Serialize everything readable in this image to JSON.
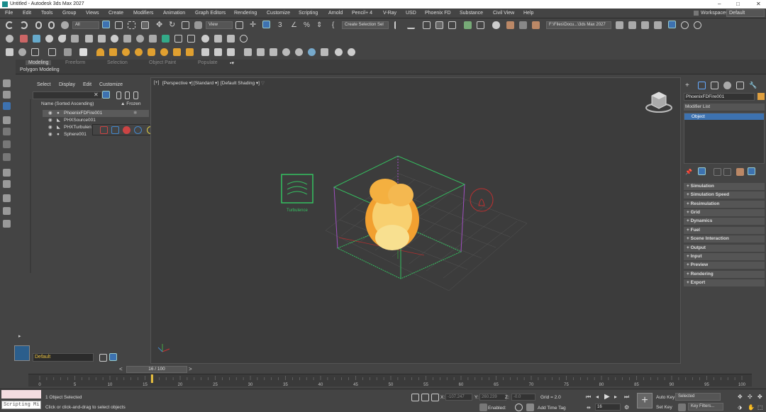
{
  "window": {
    "title": "Untitled - Autodesk 3ds Max 2027",
    "controls": [
      "–",
      "□",
      "✕"
    ]
  },
  "menubar": {
    "items": [
      "File",
      "Edit",
      "Tools",
      "Group",
      "Views",
      "Create",
      "Modifiers",
      "Animation",
      "Graph Editors",
      "Rendering",
      "Customize",
      "Scripting",
      "Arnold",
      "Pencil+ 4",
      "V-Ray",
      "USD",
      "Phoenix FD",
      "Substance",
      "Civil View",
      "Help"
    ],
    "workspace_label": "Workspaces:",
    "workspace_value": "Default"
  },
  "toolbar": {
    "selection_filter": "All",
    "ref_coord": "View",
    "named_selection": "Create Selection Sel",
    "project_path": "F:\\Files\\Docu...\\3ds Max 2027"
  },
  "ribbon": {
    "tabs": [
      "Modeling",
      "Freeform",
      "Selection",
      "Object Paint",
      "Populate"
    ],
    "active_tab": "Modeling",
    "sub_label": "Polygon Modeling"
  },
  "scene_explorer": {
    "menu": [
      "Select",
      "Display",
      "Edit",
      "Customize"
    ],
    "header_name": "Name (Sorted Ascending)",
    "header_frozen": "▲ Frozen",
    "rows": [
      "PhoenixFDFire001",
      "PHXSource001",
      "PHXTurbulen",
      "Sphere001"
    ],
    "layer": "Default"
  },
  "viewport": {
    "labels": [
      "[+]",
      "[Perspective ▾]",
      "[Standard ▾]",
      "[Default Shading ▾]"
    ],
    "turbulence_label": "Turbulence"
  },
  "command_panel": {
    "object_name": "PhoenixFDFire001",
    "modifier_list": "Modifier List",
    "stack_item": "Object",
    "rollouts": [
      "Simulation",
      "Simulation Speed",
      "Resimulation",
      "Grid",
      "Dynamics",
      "Fuel",
      "Scene Interaction",
      "Output",
      "Input",
      "Preview",
      "Rendering",
      "Export"
    ]
  },
  "timeline": {
    "slider": "16 / 100",
    "ticks": [
      "0",
      "5",
      "10",
      "15",
      "20",
      "25",
      "30",
      "35",
      "40",
      "45",
      "50",
      "55",
      "60",
      "65",
      "70",
      "75",
      "80",
      "85",
      "90",
      "95",
      "100"
    ],
    "current_frame": 16
  },
  "status": {
    "maxscript": "Scripting Mi",
    "selection": "1 Object Selected",
    "prompt": "Click or click-and-drag to select objects",
    "x_label": "X:",
    "x_value": "-107.247",
    "y_label": "Y:",
    "y_value": "260.239",
    "z_label": "Z:",
    "z_value": "-0.0",
    "grid": "Grid = 2.0",
    "enabled": "Enabled:",
    "add_time_tag": "Add Time Tag",
    "frame_field": "16",
    "auto_key": "Auto Key",
    "set_key": "Set Key",
    "selected_dropdown": "Selected",
    "key_filters": "Key Filters..."
  },
  "colors": {
    "accent_blue": "#3d72b0",
    "bbox_green": "#35c060",
    "bbox_purple": "#a050c0",
    "fire": "#f2a030"
  }
}
